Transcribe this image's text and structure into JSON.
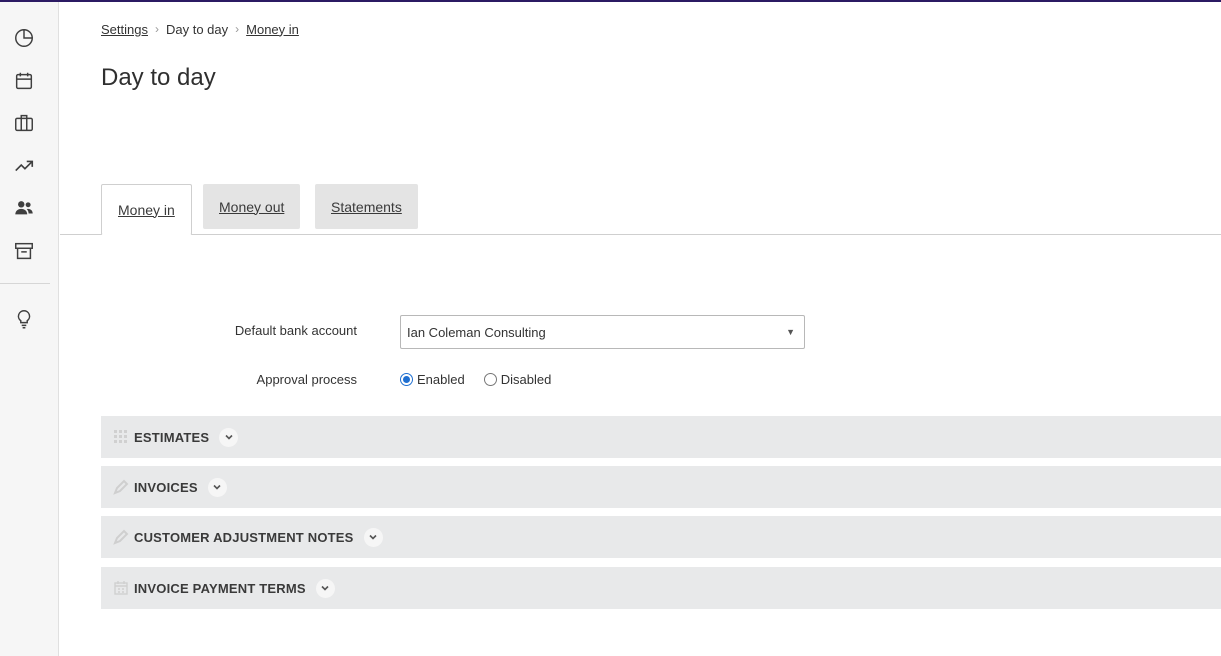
{
  "breadcrumb": {
    "items": [
      "Settings",
      "Day to day",
      "Money in"
    ],
    "separator": "›"
  },
  "page": {
    "title": "Day to day"
  },
  "tabs": [
    {
      "label": "Money in",
      "active": true
    },
    {
      "label": "Money out",
      "active": false
    },
    {
      "label": "Statements",
      "active": false
    }
  ],
  "form": {
    "default_bank_account": {
      "label": "Default bank account",
      "value": "Ian Coleman Consulting"
    },
    "approval_process": {
      "label": "Approval process",
      "options": [
        {
          "label": "Enabled",
          "checked": true
        },
        {
          "label": "Disabled",
          "checked": false
        }
      ]
    }
  },
  "sections": [
    {
      "label": "ESTIMATES",
      "icon": "grid-icon"
    },
    {
      "label": "INVOICES",
      "icon": "pencil-icon"
    },
    {
      "label": "CUSTOMER ADJUSTMENT NOTES",
      "icon": "pencil-icon"
    },
    {
      "label": "INVOICE PAYMENT TERMS",
      "icon": "calendar-icon"
    }
  ],
  "sidebar": {
    "icons": [
      "pie-chart-icon",
      "calendar-icon",
      "briefcase-icon",
      "trending-up-icon",
      "users-icon",
      "archive-icon",
      "lightbulb-icon"
    ]
  },
  "colors": {
    "accent_topline": "#2b1a63",
    "radio_checked": "#1f6fd1",
    "section_bg": "#e8e9ea"
  }
}
